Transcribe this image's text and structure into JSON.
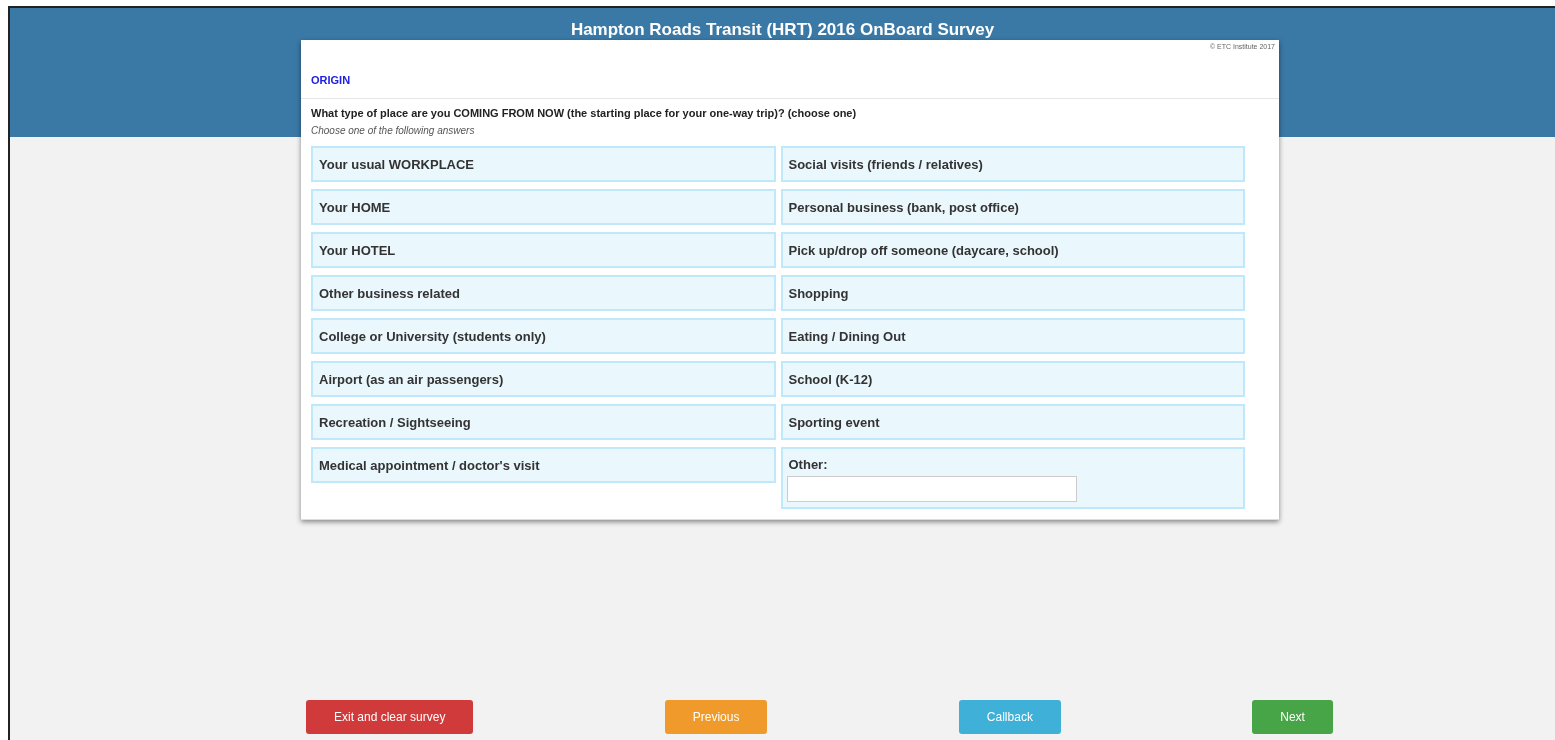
{
  "header": {
    "title": "Hampton Roads Transit (HRT) 2016 OnBoard Survey"
  },
  "card": {
    "copyright": "© ETC Institute 2017",
    "section": "ORIGIN",
    "question": "What type of place are you COMING FROM NOW (the starting place for your one-way trip)? (choose one)",
    "hint": "Choose one of the following answers",
    "options_left": [
      {
        "kind": "option",
        "label": "Your usual WORKPLACE"
      },
      {
        "kind": "option",
        "label": "Your HOME"
      },
      {
        "kind": "option",
        "label": "Your HOTEL"
      },
      {
        "kind": "option",
        "label": "Other business related"
      },
      {
        "kind": "option",
        "label": "College or University (students only)"
      },
      {
        "kind": "option",
        "label": "Airport (as an air passengers)"
      },
      {
        "kind": "option",
        "label": "Recreation / Sightseeing"
      },
      {
        "kind": "option",
        "label": "Medical appointment / doctor's visit"
      }
    ],
    "options_right": [
      {
        "kind": "option",
        "label": "Social visits (friends / relatives)"
      },
      {
        "kind": "option",
        "label": "Personal business (bank, post office)"
      },
      {
        "kind": "option",
        "label": "Pick up/drop off someone (daycare, school)"
      },
      {
        "kind": "option",
        "label": "Shopping"
      },
      {
        "kind": "option",
        "label": "Eating / Dining Out"
      },
      {
        "kind": "option",
        "label": "School (K-12)"
      },
      {
        "kind": "option",
        "label": "Sporting event"
      },
      {
        "kind": "other",
        "label": "Other:"
      }
    ]
  },
  "buttons": [
    {
      "label": "Exit and clear survey",
      "color": "#d03a3a"
    },
    {
      "label": "Previous",
      "color": "#ef9a2a"
    },
    {
      "label": "Callback",
      "color": "#3fb0d8"
    },
    {
      "label": "Next",
      "color": "#47a447"
    }
  ]
}
